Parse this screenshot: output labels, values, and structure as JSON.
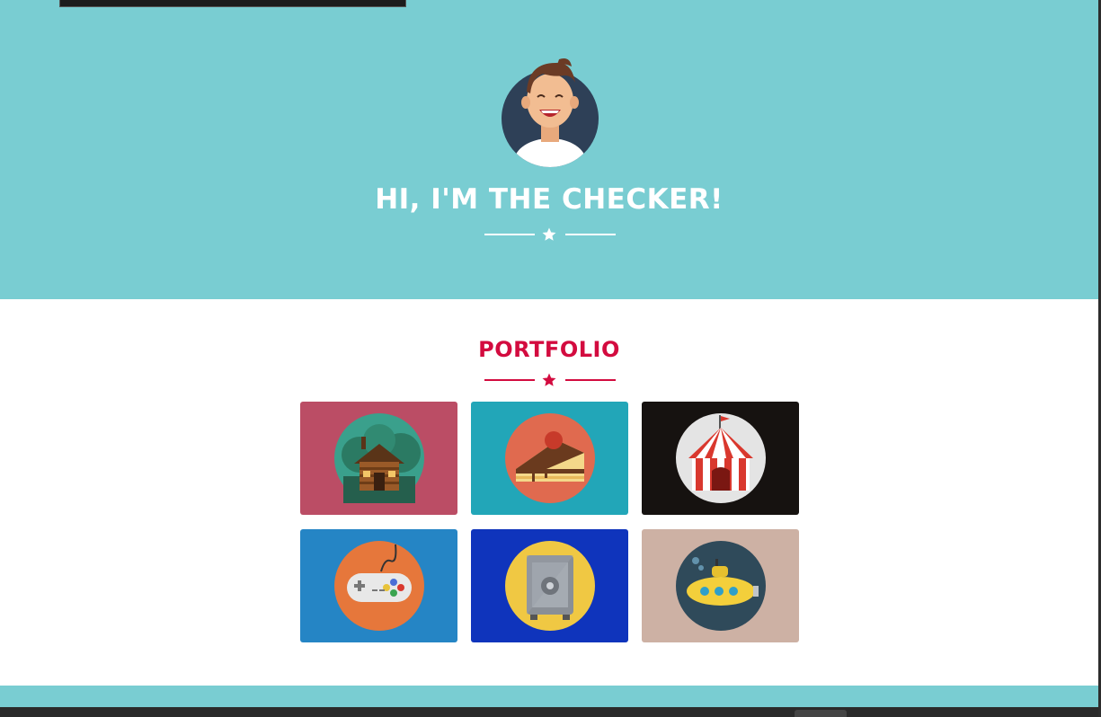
{
  "hero": {
    "title": "HI, I'M THE CHECKER!",
    "background": "#79cdd2"
  },
  "portfolio": {
    "title": "PORTFOLIO",
    "accent": "#d30b3f",
    "items": [
      {
        "name": "cabin",
        "icon": "log-cabin-icon",
        "bg": "#bb4d65"
      },
      {
        "name": "cake",
        "icon": "cake-slice-icon",
        "bg": "#22a6b8"
      },
      {
        "name": "circus",
        "icon": "circus-tent-icon",
        "bg": "#161210"
      },
      {
        "name": "game",
        "icon": "game-controller-icon",
        "bg": "#2585c5"
      },
      {
        "name": "safe",
        "icon": "safe-icon",
        "bg": "#0f34bc"
      },
      {
        "name": "submarine",
        "icon": "submarine-icon",
        "bg": "#cdb1a4"
      }
    ]
  },
  "colors": {
    "hero_bg": "#79cdd2",
    "accent": "#d30b3f",
    "white": "#ffffff"
  }
}
